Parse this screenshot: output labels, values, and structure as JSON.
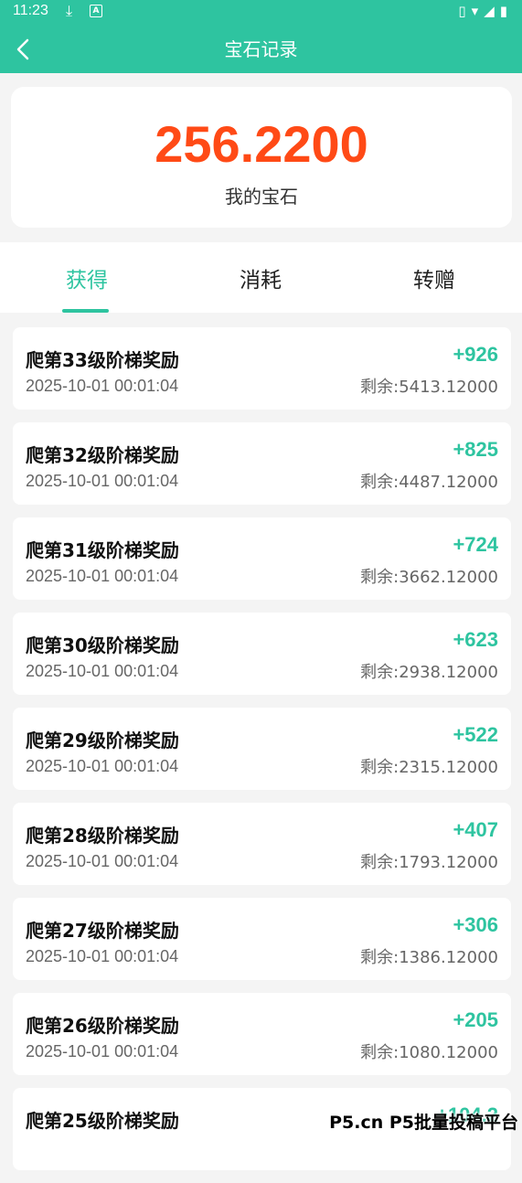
{
  "status_bar": {
    "time": "11:23",
    "right_icons": "vibrate wifi signal battery"
  },
  "nav": {
    "title": "宝石记录"
  },
  "summary": {
    "amount": "256.2200",
    "label": "我的宝石"
  },
  "tabs": [
    {
      "label": "获得",
      "active": true
    },
    {
      "label": "消耗",
      "active": false
    },
    {
      "label": "转赠",
      "active": false
    }
  ],
  "records": [
    {
      "title": "爬第33级阶梯奖励",
      "date": "2025-10-01 00:01:04",
      "amount": "+926",
      "balance": "剩余:5413.12000"
    },
    {
      "title": "爬第32级阶梯奖励",
      "date": "2025-10-01 00:01:04",
      "amount": "+825",
      "balance": "剩余:4487.12000"
    },
    {
      "title": "爬第31级阶梯奖励",
      "date": "2025-10-01 00:01:04",
      "amount": "+724",
      "balance": "剩余:3662.12000"
    },
    {
      "title": "爬第30级阶梯奖励",
      "date": "2025-10-01 00:01:04",
      "amount": "+623",
      "balance": "剩余:2938.12000"
    },
    {
      "title": "爬第29级阶梯奖励",
      "date": "2025-10-01 00:01:04",
      "amount": "+522",
      "balance": "剩余:2315.12000"
    },
    {
      "title": "爬第28级阶梯奖励",
      "date": "2025-10-01 00:01:04",
      "amount": "+407",
      "balance": "剩余:1793.12000"
    },
    {
      "title": "爬第27级阶梯奖励",
      "date": "2025-10-01 00:01:04",
      "amount": "+306",
      "balance": "剩余:1386.12000"
    },
    {
      "title": "爬第26级阶梯奖励",
      "date": "2025-10-01 00:01:04",
      "amount": "+205",
      "balance": "剩余:1080.12000"
    },
    {
      "title": "爬第25级阶梯奖励",
      "date": "",
      "amount": "+104.2",
      "balance": ""
    }
  ],
  "watermark": "P5.cn P5批量投稿平台",
  "colors": {
    "accent": "#2ec4a0",
    "amount": "#ff4a16"
  }
}
